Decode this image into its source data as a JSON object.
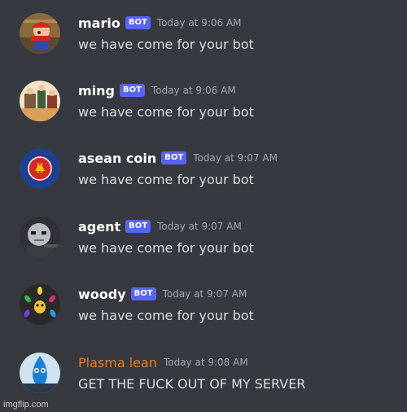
{
  "colors": {
    "background": "#36393f",
    "bot_badge": "#5865f2",
    "plasma_name": "#e67e22",
    "timestamp": "#a3a6aa",
    "message_text": "#dcddde"
  },
  "messages": [
    {
      "author": "mario",
      "badge": "BOT",
      "timestamp": "Today at 9:06 AM",
      "text": "we have come for your bot",
      "avatar_icon": "mario-avatar-icon"
    },
    {
      "author": "ming",
      "badge": "BOT",
      "timestamp": "Today at 9:06 AM",
      "text": "we have come for your bot",
      "avatar_icon": "ming-avatar-icon"
    },
    {
      "author": "asean coin",
      "badge": "BOT",
      "timestamp": "Today at 9:07 AM",
      "text": "we have come for your bot",
      "avatar_icon": "asean-coin-avatar-icon"
    },
    {
      "author": "agent",
      "badge": "BOT",
      "timestamp": "Today at 9:07 AM",
      "text": "we have come for your bot",
      "avatar_icon": "agent-avatar-icon"
    },
    {
      "author": "woody",
      "badge": "BOT",
      "timestamp": "Today at 9:07 AM",
      "text": "we have come for your bot",
      "avatar_icon": "woody-avatar-icon"
    },
    {
      "author": "Plasma lean",
      "timestamp": "Today at 9:08 AM",
      "text": "GET THE FUCK OUT OF MY SERVER",
      "avatar_icon": "plasma-lean-avatar-icon"
    }
  ],
  "watermark": "imgflip.com"
}
